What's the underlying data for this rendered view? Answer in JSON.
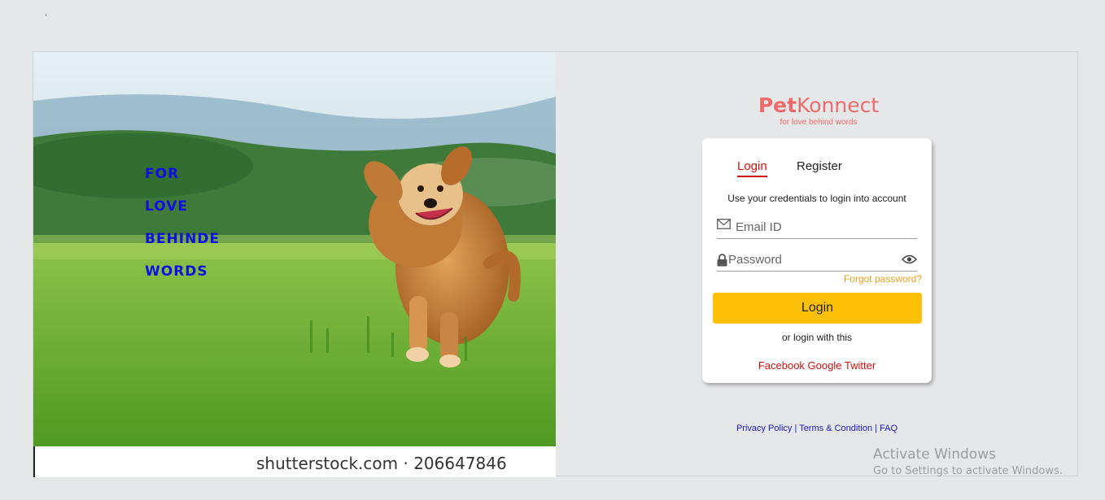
{
  "misc": {
    "dot": "."
  },
  "hero": {
    "tagline": [
      "FOR",
      "LOVE",
      "BEHINDE",
      "WORDS"
    ],
    "watermark": "shutterstock.com · 206647846"
  },
  "brand": {
    "name_bold": "Pet",
    "name_light": "Konnect",
    "subtitle": "for love behind words"
  },
  "auth": {
    "tabs": {
      "login": "Login",
      "register": "Register"
    },
    "hint": "Use your credentials to login into account",
    "email_placeholder": "Email ID",
    "password_placeholder": "Password",
    "forgot": "Forgot password?",
    "login_button": "Login",
    "or_text": "or login with this",
    "social": {
      "facebook": "Facebook",
      "google": "Google",
      "twitter": "Twitter"
    }
  },
  "footer": {
    "privacy": "Privacy Policy",
    "terms": "Terms & Condition",
    "faq": "FAQ",
    "separator": "|"
  },
  "os_overlay": {
    "title": "Activate Windows",
    "subtitle": "Go to Settings to activate Windows."
  },
  "colors": {
    "brand": "#ef6b6b",
    "accent_red": "#d01010",
    "button_yellow": "#ffc107",
    "forgot_orange": "#e8a020",
    "tagline_blue": "#1010e0",
    "footer_link": "#1a1acb"
  },
  "icons": {
    "email": "envelope-icon",
    "password": "lock-icon",
    "reveal": "eye-icon"
  }
}
